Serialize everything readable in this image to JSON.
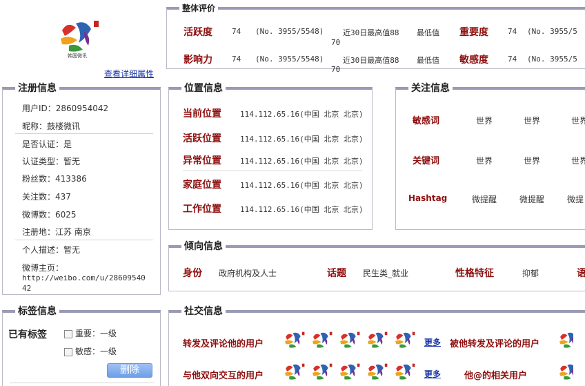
{
  "profile": {
    "detail_link": "查看详细属性",
    "logo_caption": "韩国微讯"
  },
  "overall": {
    "title": "整体评价",
    "rows": [
      {
        "label": "活跃度",
        "score": "74",
        "rank": "(No. 3955/5548)",
        "near30": "近30日最高值88",
        "near30b": "70",
        "min": "最低值",
        "label2": "重要度",
        "score2": "74",
        "rank2": "(No. 3955/5"
      },
      {
        "label": "影响力",
        "score": "74",
        "rank": "(No. 3955/5548)",
        "near30": "近30日最高值88",
        "near30b": "70",
        "min": "最低值",
        "label2": "敏感度",
        "score2": "74",
        "rank2": "(No. 3955/5"
      }
    ]
  },
  "register": {
    "title": "注册信息",
    "user_id": "用户ID：2860954042",
    "nickname": "昵称：鼓楼微讯",
    "verified": "是否认证：是",
    "verify_type": "认证类型：暂无",
    "fans": "粉丝数：413386",
    "follows": "关注数：437",
    "weibo_count": "微博数：6025",
    "location": "注册地：江苏 南京",
    "desc": "个人描述：暂无",
    "home_label": "微博主页：",
    "home_url1": "http://weibo.com/u/28609540",
    "home_url2": "42"
  },
  "position": {
    "title": "位置信息",
    "rows": [
      {
        "label": "当前位置",
        "value": "114.112.65.16(中国 北京 北京)"
      },
      {
        "label": "活跃位置",
        "value": "114.112.65.16(中国 北京 北京)"
      },
      {
        "label": "异常位置",
        "value": "114.112.65.16(中国 北京 北京)"
      },
      {
        "label": "家庭位置",
        "value": "114.112.65.16(中国 北京 北京)"
      },
      {
        "label": "工作位置",
        "value": "114.112.65.16(中国 北京 北京)"
      }
    ]
  },
  "follow": {
    "title": "关注信息",
    "rows": [
      {
        "label": "敏感词",
        "words": [
          "世界",
          "世界",
          "世界"
        ]
      },
      {
        "label": "关键词",
        "words": [
          "世界",
          "世界",
          "世界"
        ]
      },
      {
        "label": "Hashtag",
        "words": [
          "微提醒",
          "微提醒",
          "微提"
        ]
      }
    ]
  },
  "tendency": {
    "title": "倾向信息",
    "identity_label": "身份",
    "identity_value": "政府机构及人士",
    "topic_label": "话题",
    "topic_value": "民生类_就业",
    "personality_label": "性格特征",
    "personality_value": "抑郁",
    "extra_label": "语"
  },
  "tags": {
    "title": "标签信息",
    "has_tags": "已有标签",
    "items": [
      {
        "label": "重要：一级"
      },
      {
        "label": "敏感：一级"
      }
    ],
    "delete_button": "删除"
  },
  "social": {
    "title": "社交信息",
    "rows": [
      {
        "label": "转发及评论他的用户",
        "more": "更多",
        "label2": "被他转发及评论的用户"
      },
      {
        "label": "与他双向交互的用户",
        "more": "更多",
        "label2": "他@的相关用户"
      }
    ]
  },
  "colors": {
    "accent_red": "#8e0f0f",
    "panel_border": "#9a9ab4",
    "link_blue": "#1a36a8",
    "button_blue": "#7aa6e8"
  },
  "icons": {
    "logo": "gulou-logo-icon",
    "avatar": "avatar-logo-icon",
    "checkbox": "checkbox-icon"
  }
}
